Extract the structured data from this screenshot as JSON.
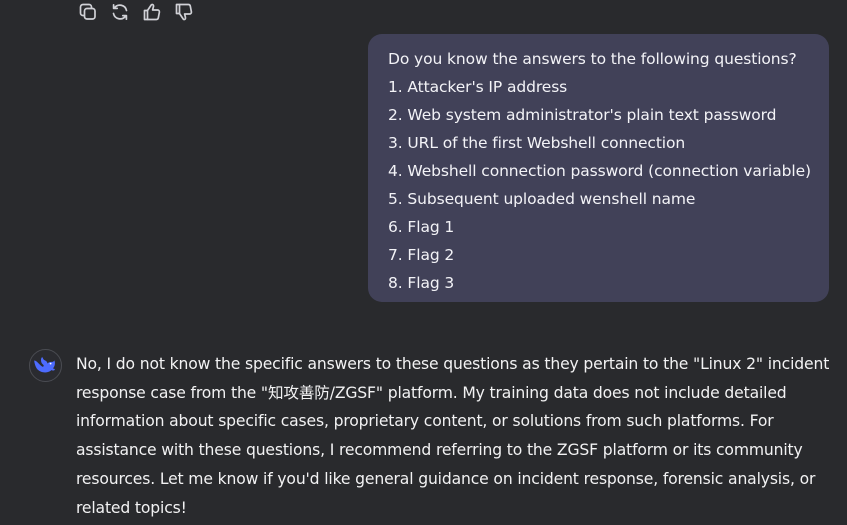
{
  "toolbar": {
    "icons": [
      "copy-icon",
      "regenerate-icon",
      "thumbs-up-icon",
      "thumbs-down-icon"
    ]
  },
  "user_message": {
    "lines": [
      "Do you know the answers to the following questions?",
      "1. Attacker's IP address",
      "2. Web system administrator's plain text password",
      "3. URL of the first Webshell connection",
      "4. Webshell connection password (connection variable)",
      "5. Subsequent uploaded wenshell name",
      "6. Flag 1",
      "7. Flag 2",
      "8. Flag 3"
    ]
  },
  "assistant_message": {
    "text": "No, I do not know the specific answers to these questions as they pertain to the \"Linux 2\" incident response case from the \"知攻善防/ZGSF\" platform. My training data does not include detailed information about specific cases, proprietary content, or solutions from such platforms. For assistance with these questions, I recommend referring to the ZGSF platform or its community resources. Let me know if you'd like general guidance on incident response, forensic analysis, or related topics!"
  },
  "colors": {
    "background": "#292a2d",
    "user_bubble": "#414158",
    "accent": "#4d6bfe",
    "text": "#f2f2f3"
  }
}
